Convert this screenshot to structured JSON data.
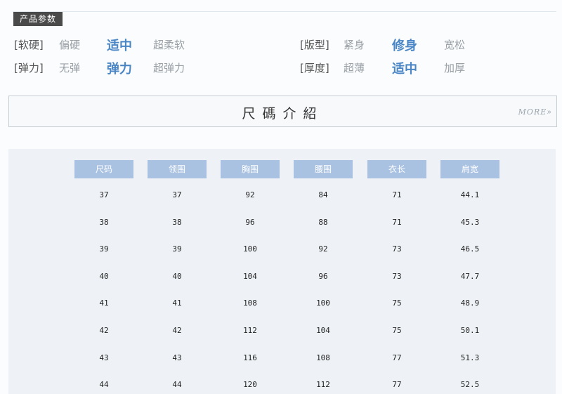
{
  "section_badge": "产品参数",
  "attributes": {
    "left": [
      {
        "key": "[软硬]",
        "options": [
          "偏硬",
          "适中",
          "超柔软"
        ],
        "selected": 1
      },
      {
        "key": "[弹力]",
        "options": [
          "无弹",
          "弹力",
          "超弹力"
        ],
        "selected": 1
      }
    ],
    "right": [
      {
        "key": "[版型]",
        "options": [
          "紧身",
          "修身",
          "宽松"
        ],
        "selected": 1
      },
      {
        "key": "[厚度]",
        "options": [
          "超薄",
          "适中",
          "加厚"
        ],
        "selected": 1
      }
    ]
  },
  "banner": {
    "title": "尺碼介紹",
    "more": "MORE»"
  },
  "size_table": {
    "headers": [
      "尺码",
      "领围",
      "胸围",
      "腰围",
      "衣长",
      "肩宽"
    ],
    "rows": [
      [
        "37",
        "37",
        "92",
        "84",
        "71",
        "44.1"
      ],
      [
        "38",
        "38",
        "96",
        "88",
        "71",
        "45.3"
      ],
      [
        "39",
        "39",
        "100",
        "92",
        "73",
        "46.5"
      ],
      [
        "40",
        "40",
        "104",
        "96",
        "73",
        "47.7"
      ],
      [
        "41",
        "41",
        "108",
        "100",
        "75",
        "48.9"
      ],
      [
        "42",
        "42",
        "112",
        "104",
        "75",
        "50.1"
      ],
      [
        "43",
        "43",
        "116",
        "108",
        "77",
        "51.3"
      ],
      [
        "44",
        "44",
        "120",
        "112",
        "77",
        "52.5"
      ]
    ]
  },
  "colors": {
    "selected_option": "#4a86c5",
    "header_fill": "#a9c2e2",
    "table_background": "#eef2f6"
  }
}
